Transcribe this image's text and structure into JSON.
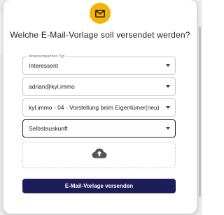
{
  "dialog": {
    "title": "Welche E-Mail-Vorlage soll versendet werden?",
    "header_icon": "mail-icon",
    "accent_color": "#f5b400"
  },
  "fields": [
    {
      "label": "Ansprechpartner-Typ",
      "value": "Interessent"
    },
    {
      "value": "adrian@kyl.immo"
    },
    {
      "value": "kyl.immo - 04 - Vorstellung beim Eigentümer(neu)"
    },
    {
      "value": "Selbstauskunft"
    }
  ],
  "upload": {
    "icon": "cloud-upload-icon"
  },
  "submit": {
    "label": "E-Mail-Vorlage versenden",
    "color": "#1e1d5a"
  }
}
